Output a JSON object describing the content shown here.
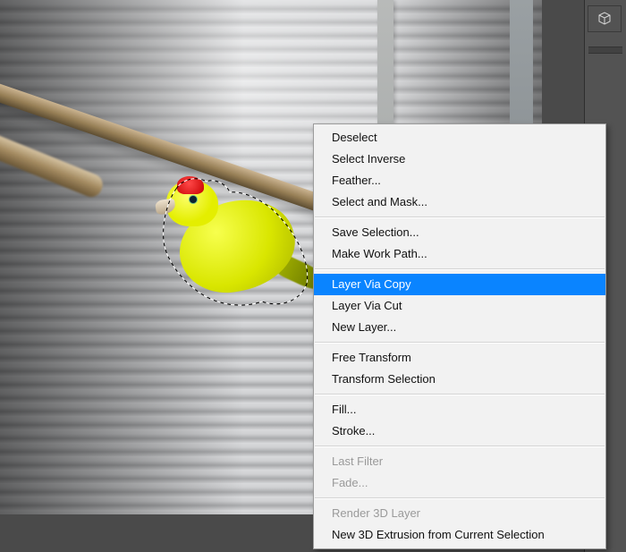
{
  "context_menu": {
    "groups": [
      [
        {
          "key": "deselect",
          "label": "Deselect",
          "enabled": true
        },
        {
          "key": "select_inverse",
          "label": "Select Inverse",
          "enabled": true
        },
        {
          "key": "feather",
          "label": "Feather...",
          "enabled": true
        },
        {
          "key": "select_and_mask",
          "label": "Select and Mask...",
          "enabled": true
        }
      ],
      [
        {
          "key": "save_selection",
          "label": "Save Selection...",
          "enabled": true
        },
        {
          "key": "make_work_path",
          "label": "Make Work Path...",
          "enabled": true
        }
      ],
      [
        {
          "key": "layer_via_copy",
          "label": "Layer Via Copy",
          "enabled": true,
          "highlight": true
        },
        {
          "key": "layer_via_cut",
          "label": "Layer Via Cut",
          "enabled": true
        },
        {
          "key": "new_layer",
          "label": "New Layer...",
          "enabled": true
        }
      ],
      [
        {
          "key": "free_transform",
          "label": "Free Transform",
          "enabled": true
        },
        {
          "key": "transform_selection",
          "label": "Transform Selection",
          "enabled": true
        }
      ],
      [
        {
          "key": "fill",
          "label": "Fill...",
          "enabled": true
        },
        {
          "key": "stroke",
          "label": "Stroke...",
          "enabled": true
        }
      ],
      [
        {
          "key": "last_filter",
          "label": "Last Filter",
          "enabled": false
        },
        {
          "key": "fade",
          "label": "Fade...",
          "enabled": false
        }
      ],
      [
        {
          "key": "render_3d_layer",
          "label": "Render 3D Layer",
          "enabled": false
        },
        {
          "key": "new_3d_extrusion",
          "label": "New 3D Extrusion from Current Selection",
          "enabled": true
        }
      ]
    ]
  },
  "right_panel": {
    "icon": "3d-panel-icon"
  },
  "canvas": {
    "has_selection": true,
    "selection_subject": "bird"
  }
}
